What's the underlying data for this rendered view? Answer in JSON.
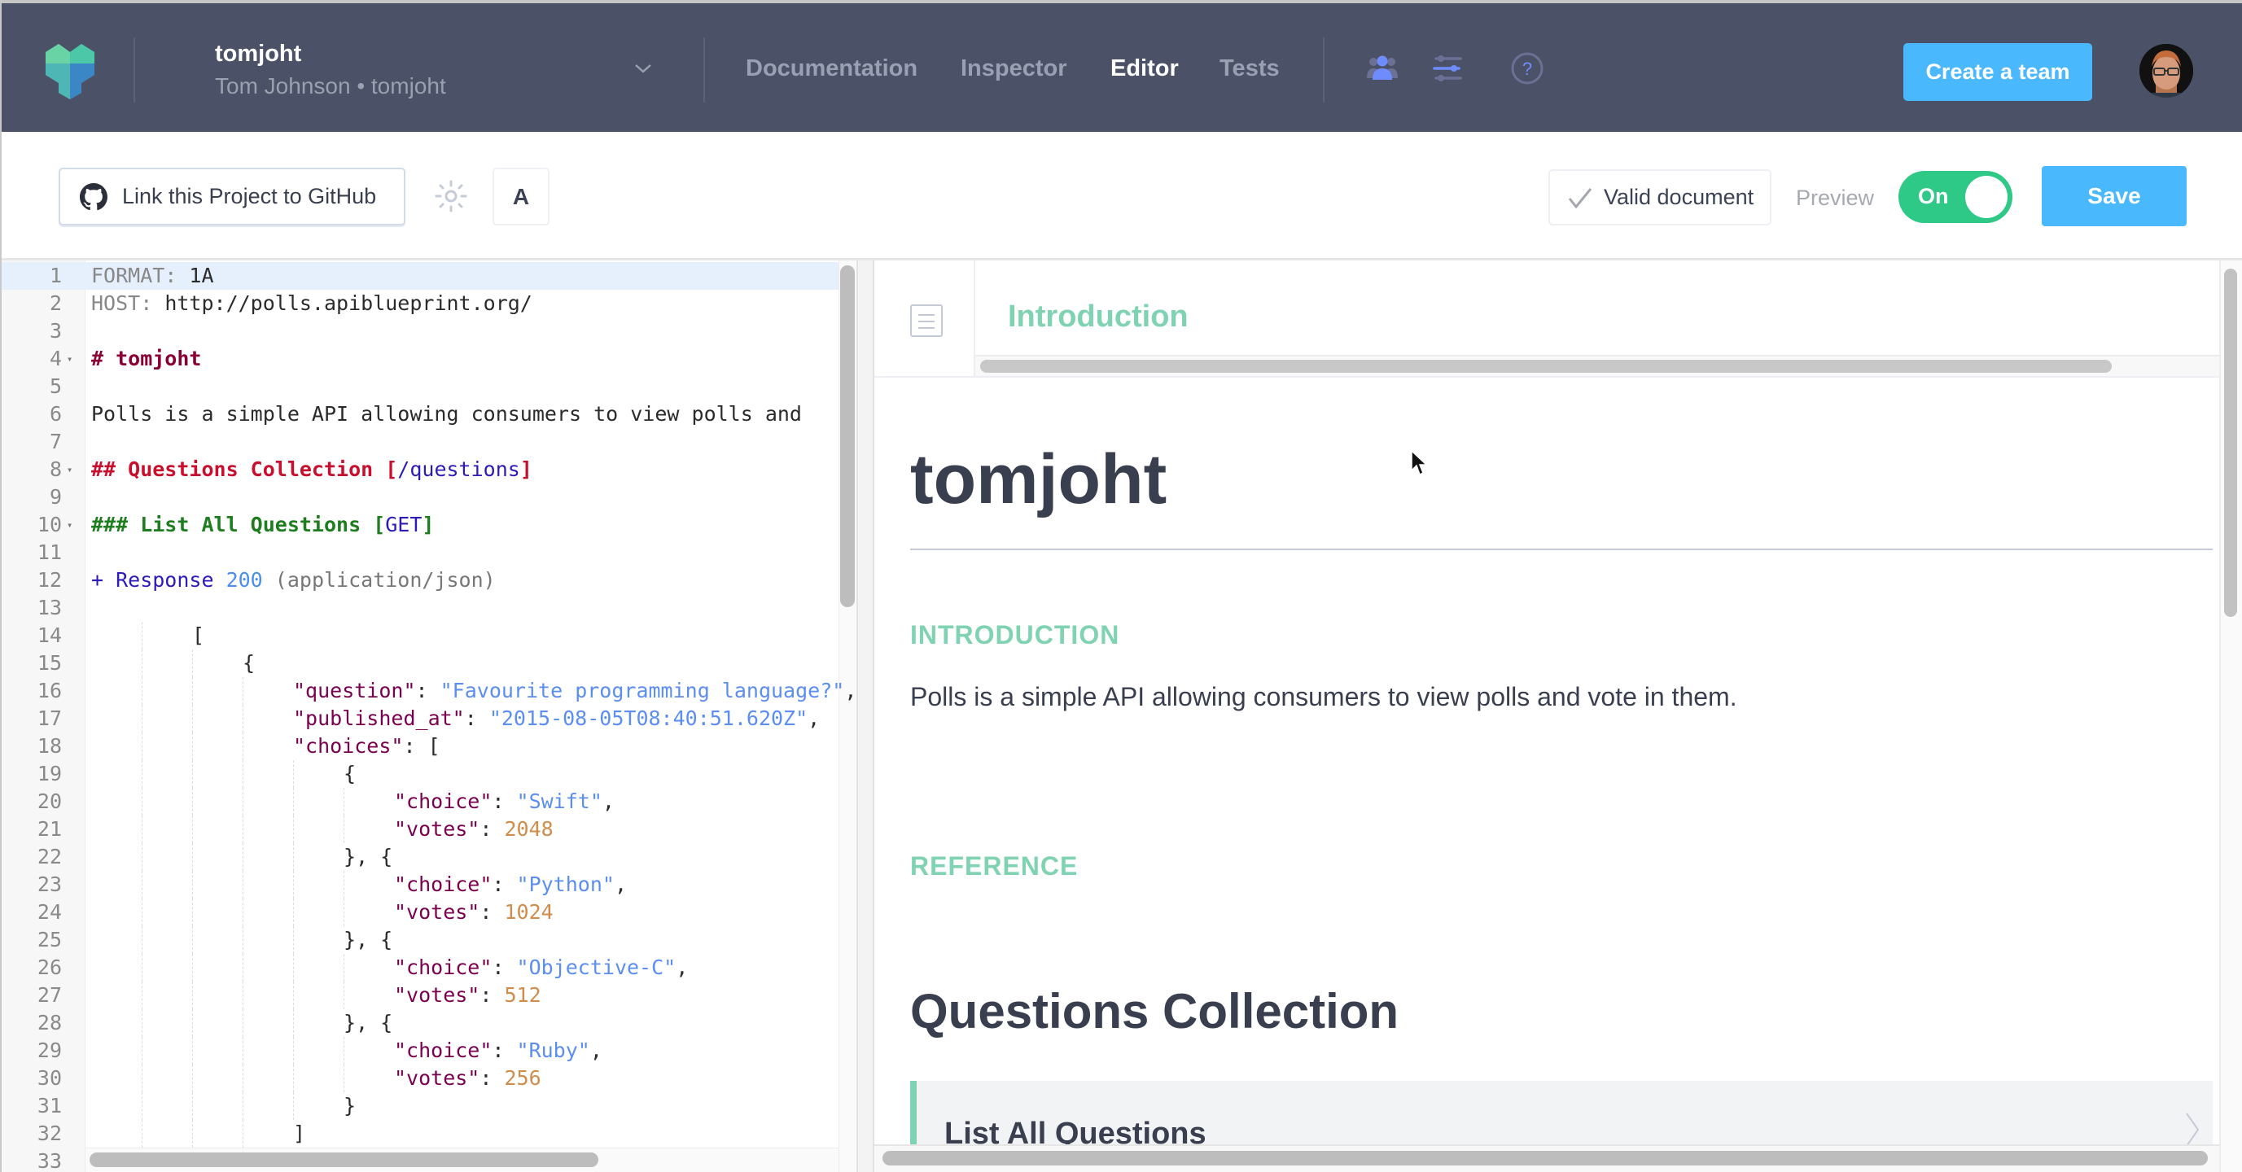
{
  "header": {
    "logo": "apiary-logo-icon",
    "account": {
      "name": "tomjoht",
      "subtitle": "Tom Johnson • tomjoht",
      "dropdown_icon": "chevron-down-icon"
    },
    "nav": [
      {
        "label": "Documentation",
        "active": false
      },
      {
        "label": "Inspector",
        "active": false
      },
      {
        "label": "Editor",
        "active": true
      },
      {
        "label": "Tests",
        "active": false
      }
    ],
    "icons": [
      "team-icon",
      "sliders-icon",
      "help-icon"
    ],
    "create_team_label": "Create a team",
    "avatar": "user-avatar"
  },
  "toolbar": {
    "github_label": "Link this Project to GitHub",
    "theme_icon": "sun-icon",
    "font_label": "A",
    "valid_label": "Valid document",
    "preview_label": "Preview",
    "toggle_label": "On",
    "toggle_on": true,
    "save_label": "Save"
  },
  "editor": {
    "lines": [
      {
        "n": "1",
        "fold": false,
        "indent": 0,
        "tokens": [
          {
            "t": "FORMAT:",
            "c": "c-key"
          },
          {
            "t": " 1A",
            "c": ""
          }
        ]
      },
      {
        "n": "2",
        "fold": false,
        "indent": 0,
        "tokens": [
          {
            "t": "HOST:",
            "c": "c-key"
          },
          {
            "t": " http://polls.apiblueprint.org/",
            "c": ""
          }
        ]
      },
      {
        "n": "3",
        "fold": false,
        "indent": 0,
        "tokens": []
      },
      {
        "n": "4",
        "fold": true,
        "indent": 0,
        "tokens": [
          {
            "t": "# tomjoht",
            "c": "c-h1"
          }
        ]
      },
      {
        "n": "5",
        "fold": false,
        "indent": 0,
        "tokens": []
      },
      {
        "n": "6",
        "fold": false,
        "indent": 0,
        "tokens": [
          {
            "t": "Polls is a simple API allowing consumers to view polls and",
            "c": ""
          }
        ]
      },
      {
        "n": "7",
        "fold": false,
        "indent": 0,
        "tokens": []
      },
      {
        "n": "8",
        "fold": true,
        "indent": 0,
        "tokens": [
          {
            "t": "## Questions Collection ",
            "c": "c-h2"
          },
          {
            "t": "[",
            "c": "c-h2"
          },
          {
            "t": "/questions",
            "c": "c-uri"
          },
          {
            "t": "]",
            "c": "c-h2"
          }
        ]
      },
      {
        "n": "9",
        "fold": false,
        "indent": 0,
        "tokens": []
      },
      {
        "n": "10",
        "fold": true,
        "indent": 0,
        "tokens": [
          {
            "t": "### List All Questions ",
            "c": "c-h3"
          },
          {
            "t": "[",
            "c": "c-h3"
          },
          {
            "t": "GET",
            "c": "c-uri"
          },
          {
            "t": "]",
            "c": "c-h3"
          }
        ]
      },
      {
        "n": "11",
        "fold": false,
        "indent": 0,
        "tokens": []
      },
      {
        "n": "12",
        "fold": false,
        "indent": 0,
        "tokens": [
          {
            "t": "+ Response ",
            "c": "c-plus"
          },
          {
            "t": "200",
            "c": "c-num"
          },
          {
            "t": " (application/json)",
            "c": "c-ct"
          }
        ]
      },
      {
        "n": "13",
        "fold": false,
        "indent": 0,
        "tokens": []
      },
      {
        "n": "14",
        "fold": false,
        "indent": 2,
        "tokens": [
          {
            "t": "[",
            "c": ""
          }
        ]
      },
      {
        "n": "15",
        "fold": false,
        "indent": 3,
        "tokens": [
          {
            "t": "{",
            "c": ""
          }
        ]
      },
      {
        "n": "16",
        "fold": false,
        "indent": 4,
        "tokens": [
          {
            "t": "\"question\"",
            "c": "c-prop"
          },
          {
            "t": ": ",
            "c": ""
          },
          {
            "t": "\"Favourite programming language?\"",
            "c": "c-str"
          },
          {
            "t": ",",
            "c": ""
          }
        ]
      },
      {
        "n": "17",
        "fold": false,
        "indent": 4,
        "tokens": [
          {
            "t": "\"published_at\"",
            "c": "c-prop"
          },
          {
            "t": ": ",
            "c": ""
          },
          {
            "t": "\"2015-08-05T08:40:51.620Z\"",
            "c": "c-str"
          },
          {
            "t": ",",
            "c": ""
          }
        ]
      },
      {
        "n": "18",
        "fold": false,
        "indent": 4,
        "tokens": [
          {
            "t": "\"choices\"",
            "c": "c-prop"
          },
          {
            "t": ": [",
            "c": ""
          }
        ]
      },
      {
        "n": "19",
        "fold": false,
        "indent": 5,
        "tokens": [
          {
            "t": "{",
            "c": ""
          }
        ]
      },
      {
        "n": "20",
        "fold": false,
        "indent": 6,
        "tokens": [
          {
            "t": "\"choice\"",
            "c": "c-prop"
          },
          {
            "t": ": ",
            "c": ""
          },
          {
            "t": "\"Swift\"",
            "c": "c-str"
          },
          {
            "t": ",",
            "c": ""
          }
        ]
      },
      {
        "n": "21",
        "fold": false,
        "indent": 6,
        "tokens": [
          {
            "t": "\"votes\"",
            "c": "c-prop"
          },
          {
            "t": ": ",
            "c": ""
          },
          {
            "t": "2048",
            "c": "c-int"
          }
        ]
      },
      {
        "n": "22",
        "fold": false,
        "indent": 5,
        "tokens": [
          {
            "t": "}, {",
            "c": ""
          }
        ]
      },
      {
        "n": "23",
        "fold": false,
        "indent": 6,
        "tokens": [
          {
            "t": "\"choice\"",
            "c": "c-prop"
          },
          {
            "t": ": ",
            "c": ""
          },
          {
            "t": "\"Python\"",
            "c": "c-str"
          },
          {
            "t": ",",
            "c": ""
          }
        ]
      },
      {
        "n": "24",
        "fold": false,
        "indent": 6,
        "tokens": [
          {
            "t": "\"votes\"",
            "c": "c-prop"
          },
          {
            "t": ": ",
            "c": ""
          },
          {
            "t": "1024",
            "c": "c-int"
          }
        ]
      },
      {
        "n": "25",
        "fold": false,
        "indent": 5,
        "tokens": [
          {
            "t": "}, {",
            "c": ""
          }
        ]
      },
      {
        "n": "26",
        "fold": false,
        "indent": 6,
        "tokens": [
          {
            "t": "\"choice\"",
            "c": "c-prop"
          },
          {
            "t": ": ",
            "c": ""
          },
          {
            "t": "\"Objective-C\"",
            "c": "c-str"
          },
          {
            "t": ",",
            "c": ""
          }
        ]
      },
      {
        "n": "27",
        "fold": false,
        "indent": 6,
        "tokens": [
          {
            "t": "\"votes\"",
            "c": "c-prop"
          },
          {
            "t": ": ",
            "c": ""
          },
          {
            "t": "512",
            "c": "c-int"
          }
        ]
      },
      {
        "n": "28",
        "fold": false,
        "indent": 5,
        "tokens": [
          {
            "t": "}, {",
            "c": ""
          }
        ]
      },
      {
        "n": "29",
        "fold": false,
        "indent": 6,
        "tokens": [
          {
            "t": "\"choice\"",
            "c": "c-prop"
          },
          {
            "t": ": ",
            "c": ""
          },
          {
            "t": "\"Ruby\"",
            "c": "c-str"
          },
          {
            "t": ",",
            "c": ""
          }
        ]
      },
      {
        "n": "30",
        "fold": false,
        "indent": 6,
        "tokens": [
          {
            "t": "\"votes\"",
            "c": "c-prop"
          },
          {
            "t": ": ",
            "c": ""
          },
          {
            "t": "256",
            "c": "c-int"
          }
        ]
      },
      {
        "n": "31",
        "fold": false,
        "indent": 5,
        "tokens": [
          {
            "t": "}",
            "c": ""
          }
        ]
      },
      {
        "n": "32",
        "fold": false,
        "indent": 4,
        "tokens": [
          {
            "t": "]",
            "c": ""
          }
        ]
      },
      {
        "n": "33",
        "fold": false,
        "indent": 0,
        "tokens": []
      }
    ]
  },
  "preview": {
    "toc_icon": "table-of-contents-icon",
    "breadcrumb": "Introduction",
    "title": "tomjoht",
    "intro_label": "INTRODUCTION",
    "intro_text": "Polls is a simple API allowing consumers to view polls and vote in them.",
    "reference_label": "REFERENCE",
    "group_title": "Questions Collection",
    "action_title": "List All Questions",
    "action_icon": "chevron-right-icon"
  },
  "colors": {
    "header_bg": "#4b5166",
    "accent_blue": "#4ab8fc",
    "accent_green": "#2ec986",
    "section_green": "#7fd3b2",
    "text_dark": "#3a3f50"
  }
}
